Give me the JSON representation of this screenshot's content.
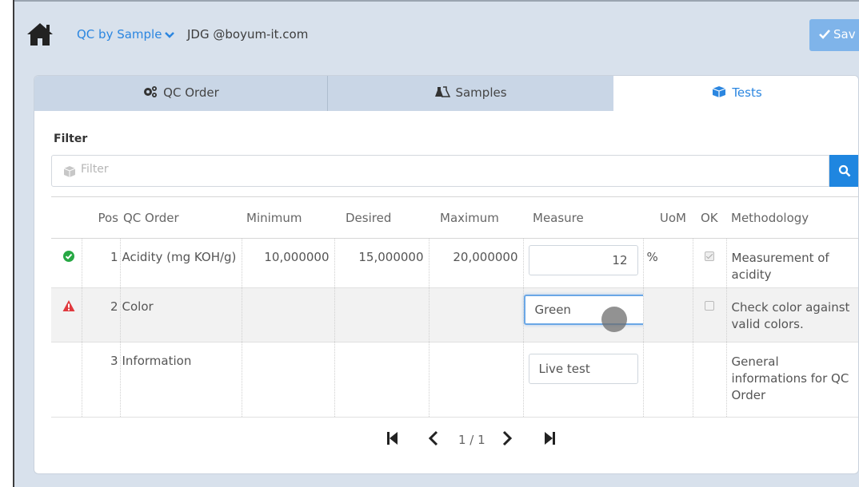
{
  "header": {
    "app_title": "QC by Sample",
    "user": "JDG @boyum-it.com",
    "save_label": "Sav"
  },
  "tabs": [
    {
      "label": "QC Order",
      "icon": "cogs-icon",
      "active": false
    },
    {
      "label": "Samples",
      "icon": "flask-icon",
      "active": false
    },
    {
      "label": "Tests",
      "icon": "cube-icon",
      "active": true
    }
  ],
  "filter": {
    "label": "Filter",
    "placeholder": "Filter"
  },
  "table": {
    "columns": [
      "Pos",
      "QC Order",
      "Minimum",
      "Desired",
      "Maximum",
      "Measure",
      "UoM",
      "OK",
      "Methodology"
    ],
    "rows": [
      {
        "status": "ok",
        "pos": "1",
        "name": "Acidity (mg KOH/g)",
        "minimum": "10,000000",
        "desired": "15,000000",
        "maximum": "20,000000",
        "measure": "12",
        "uom": "%",
        "ok": true,
        "methodology": "Measurement of acidity"
      },
      {
        "status": "warning",
        "pos": "2",
        "name": "Color",
        "minimum": "",
        "desired": "",
        "maximum": "",
        "measure": "Green",
        "uom": "",
        "ok": false,
        "methodology": "Check color against valid colors."
      },
      {
        "status": "none",
        "pos": "3",
        "name": "Information",
        "minimum": "",
        "desired": "",
        "maximum": "",
        "measure": "Live test",
        "uom": "",
        "ok": null,
        "methodology": "General informations for QC Order"
      }
    ]
  },
  "pager": {
    "page_label": "1 / 1"
  },
  "colors": {
    "accent": "#2b86e0",
    "header_bg": "#d8e1ec",
    "ok_green": "#27a844",
    "warning_red": "#e0393e"
  }
}
